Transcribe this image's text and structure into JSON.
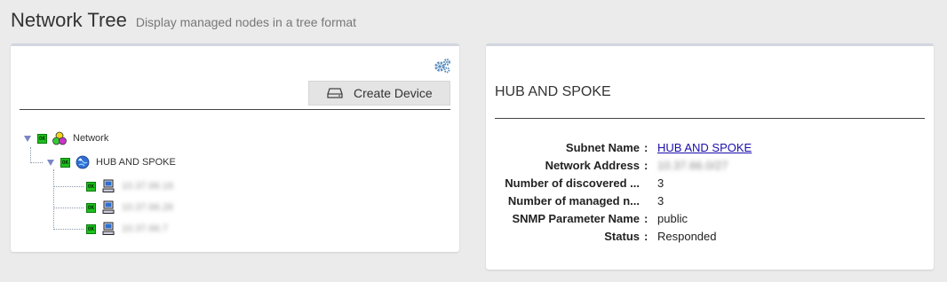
{
  "header": {
    "title": "Network Tree",
    "subtitle": "Display managed nodes in a tree format"
  },
  "left_panel": {
    "settings_icon": "gears-icon",
    "create_button_label": "Create Device",
    "tree": {
      "root": {
        "status": "OK",
        "label": "Network",
        "icon": "network-icon"
      },
      "subnet": {
        "status": "OK",
        "label": "HUB AND SPOKE",
        "icon": "globe-icon"
      },
      "devices": [
        {
          "status": "OK",
          "label": "10.37.66.16",
          "icon": "computer-icon"
        },
        {
          "status": "OK",
          "label": "10.37.66.26",
          "icon": "computer-icon"
        },
        {
          "status": "OK",
          "label": "10.37.66.7",
          "icon": "computer-icon"
        }
      ]
    }
  },
  "right_panel": {
    "title": "HUB AND SPOKE",
    "rows": [
      {
        "key": "Subnet Name",
        "value": "HUB AND SPOKE",
        "link": true
      },
      {
        "key": "Network Address",
        "value": "10.37.66.0/27",
        "blurred": true
      },
      {
        "key": "Number of discovered ...",
        "value": "3"
      },
      {
        "key": "Number of managed n...",
        "value": "3"
      },
      {
        "key": "SNMP Parameter Name",
        "value": "public"
      },
      {
        "key": "Status",
        "value": "Responded"
      }
    ],
    "separator": ":"
  },
  "colors": {
    "ok_badge": "#1fbf1f",
    "link": "#1a0dab",
    "panel_top_border": "#d2d6de",
    "background": "#ebebeb"
  }
}
